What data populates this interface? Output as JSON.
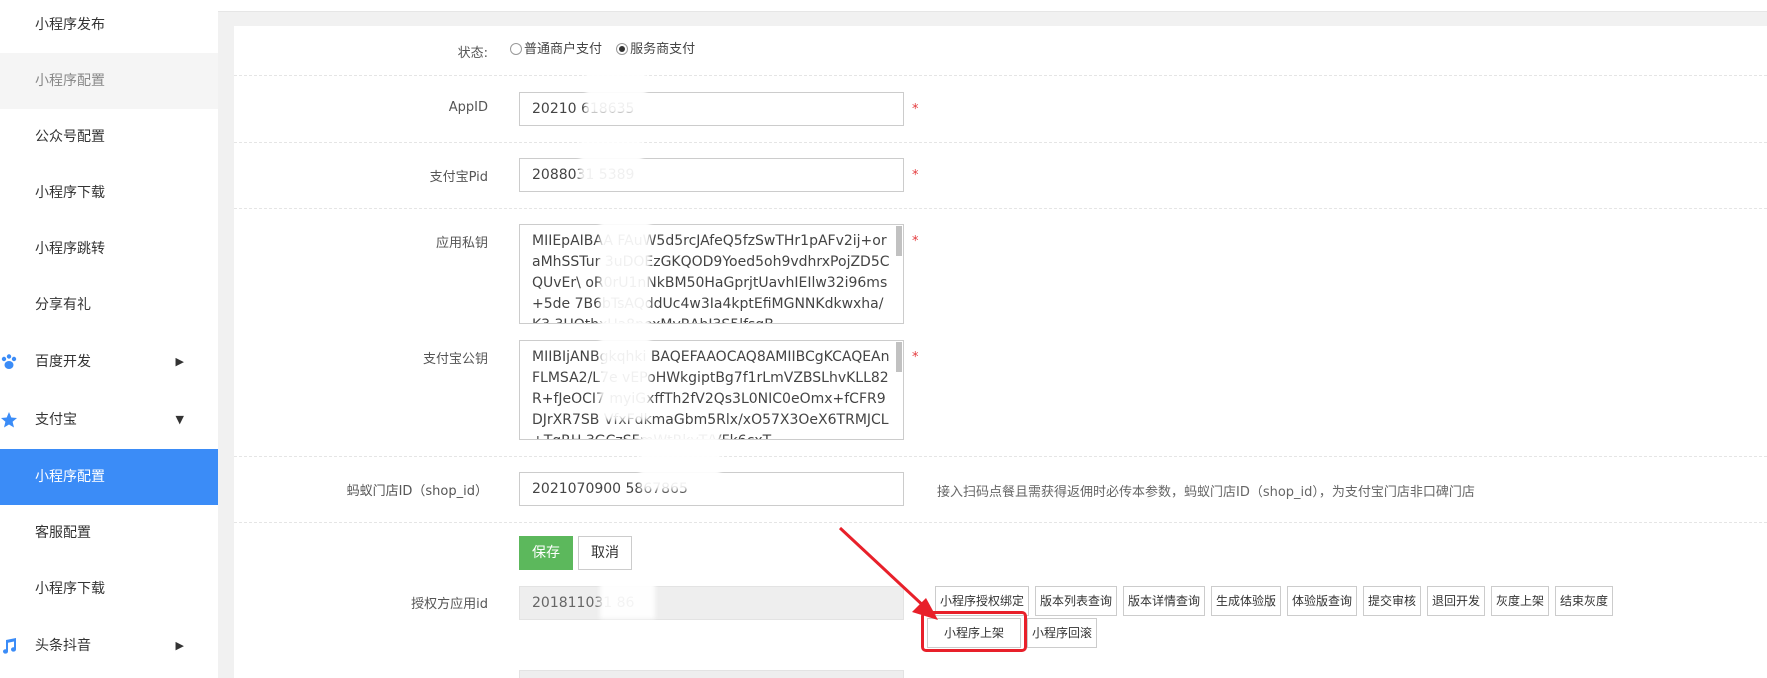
{
  "sidebar": {
    "items": [
      {
        "label": "小程序发布"
      },
      {
        "label": "小程序配置"
      },
      {
        "label": "公众号配置"
      },
      {
        "label": "小程序下载"
      },
      {
        "label": "小程序跳转"
      },
      {
        "label": "分享有礼"
      },
      {
        "label": "百度开发"
      },
      {
        "label": "支付宝"
      },
      {
        "label": "小程序配置"
      },
      {
        "label": "客服配置"
      },
      {
        "label": "小程序下载"
      },
      {
        "label": "头条抖音"
      }
    ]
  },
  "form": {
    "status": {
      "label": "状态:",
      "options": [
        "普通商户支付",
        "服务商支付"
      ],
      "selected": "服务商支付"
    },
    "appid": {
      "label": "AppID",
      "value": "20210      618635"
    },
    "pid": {
      "label": "支付宝Pid",
      "value": "2088031      5389"
    },
    "private_key": {
      "label": "应用私钥",
      "value": "MIIEpAIBAA      FAuW5d5rcJAfeQ5fzSwTHr1pAFv2ij+oraMhSSTur      3uDOEzGKQOD9Yoed5oh9vdhrxPojZD5CQUvEr\\      oR0rU1nNkBM50HaGprjtUavhIEIlw32i96ms+5de      7B6bTsAQddUc4w3Ia4kptEfiMGNNKdkwxha/K3      3UOthxUa8noxMvRAhJ3S5lfsqB"
    },
    "public_key": {
      "label": "支付宝公钥",
      "value": "MIIBIjANBgkqhki      BAQEFAAOCAQ8AMIIBCgKCAQEAnFLMSA2/L7e      vEPoHWkgiptBg7f1rLmVZBSLhvKLL82R+fJeOCI7      myiGxffTh2fV2Qs3L0NIC0eOmx+fCFR9DJrXR7SB      VfxFdkmaGbm5Rlx/xO57X3OeX6TRMJCL+TqRH      3GCzSFmWtRkvT/VFk6cxT"
    },
    "shop_id": {
      "label": "蚂蚁门店ID（shop_id）",
      "value": "2021070900      5867865",
      "hint": "接入扫码点餐且需获得返佣时必传本参数，蚂蚁门店ID（shop_id），为支付宝门店非口碑门店"
    },
    "required_mark": "*",
    "save_label": "保存",
    "cancel_label": "取消",
    "auth_app": {
      "label": "授权方应用id",
      "value": "201811031      86"
    }
  },
  "action_buttons": [
    "小程序授权绑定",
    "版本列表查询",
    "版本详情查询",
    "生成体验版",
    "体验版查询",
    "提交审核",
    "退回开发",
    "灰度上架",
    "结束灰度",
    "小程序上架",
    "小程序回滚"
  ],
  "colors": {
    "active": "#3b8cf7",
    "save": "#5cb85c",
    "highlight": "#e8202a"
  }
}
